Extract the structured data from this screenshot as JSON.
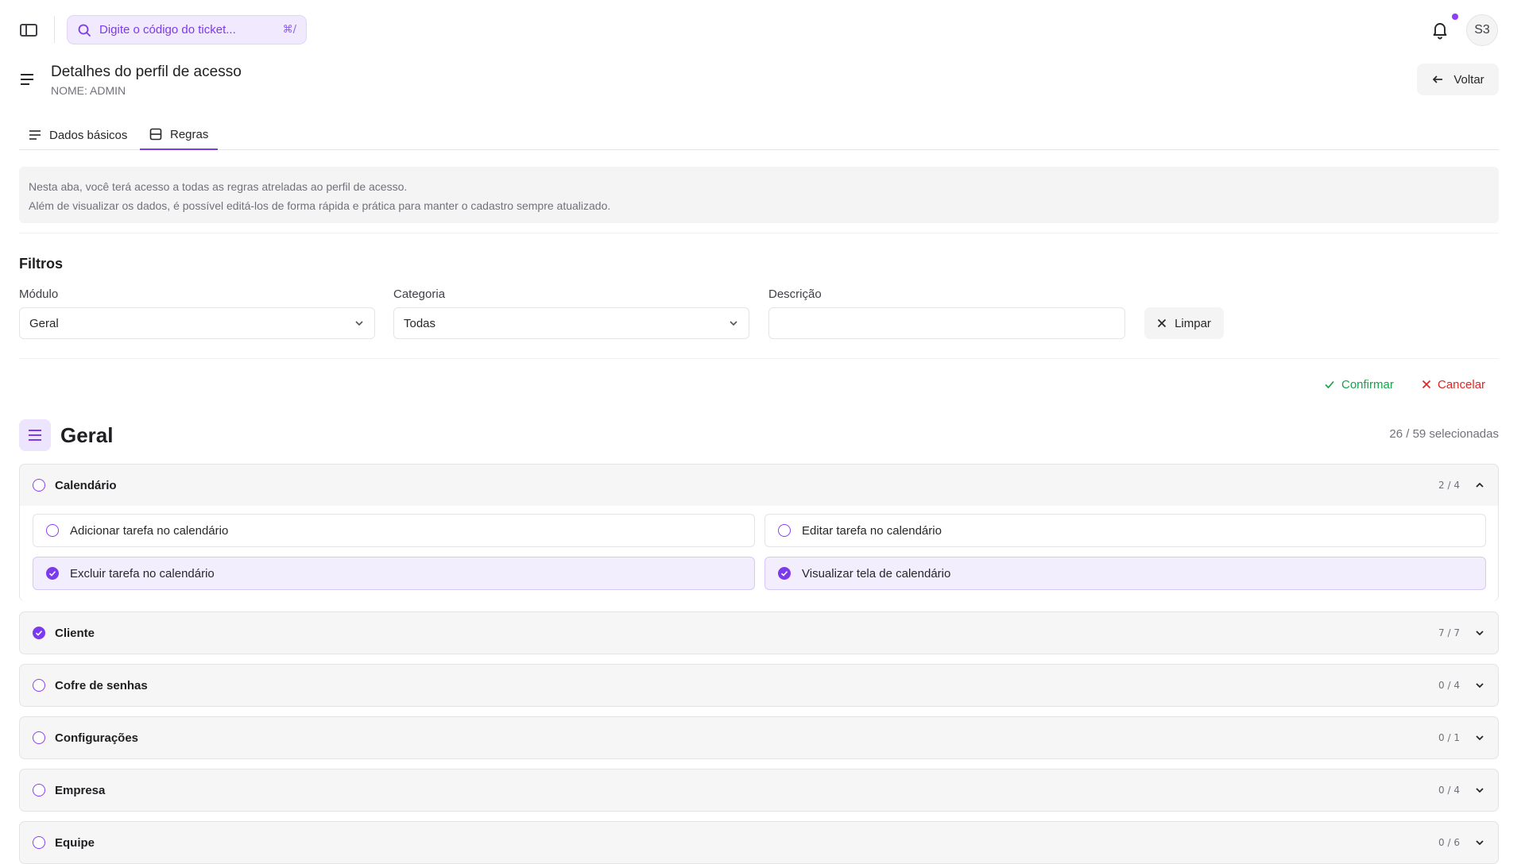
{
  "topbar": {
    "search_placeholder": "Digite o código do ticket...",
    "search_shortcut": "⌘/",
    "avatar_initials": "S3"
  },
  "header": {
    "title": "Detalhes do perfil de acesso",
    "subtitle": "NOME: ADMIN",
    "back_label": "Voltar"
  },
  "tabs": [
    {
      "label": "Dados básicos",
      "active": false
    },
    {
      "label": "Regras",
      "active": true
    }
  ],
  "info": {
    "line1": "Nesta aba, você terá acesso a todas as regras atreladas ao perfil de acesso.",
    "line2": "Além de visualizar os dados, é possível editá-los de forma rápida e prática para manter o cadastro sempre atualizado."
  },
  "filters": {
    "title": "Filtros",
    "modulo_label": "Módulo",
    "modulo_value": "Geral",
    "categoria_label": "Categoria",
    "categoria_value": "Todas",
    "descricao_label": "Descrição",
    "descricao_value": "",
    "clear_label": "Limpar"
  },
  "actions": {
    "confirm_label": "Confirmar",
    "cancel_label": "Cancelar"
  },
  "section": {
    "title": "Geral",
    "count": "26 / 59 selecionadas"
  },
  "groups": [
    {
      "name": "Calendário",
      "count": "2 / 4",
      "checked": false,
      "expanded": true,
      "rules": [
        {
          "label": "Adicionar tarefa no calendário",
          "checked": false
        },
        {
          "label": "Editar tarefa no calendário",
          "checked": false
        },
        {
          "label": "Excluir tarefa no calendário",
          "checked": true
        },
        {
          "label": "Visualizar tela de calendário",
          "checked": true
        }
      ]
    },
    {
      "name": "Cliente",
      "count": "7 / 7",
      "checked": true,
      "expanded": false
    },
    {
      "name": "Cofre de senhas",
      "count": "0 / 4",
      "checked": false,
      "expanded": false
    },
    {
      "name": "Configurações",
      "count": "0 / 1",
      "checked": false,
      "expanded": false
    },
    {
      "name": "Empresa",
      "count": "0 / 4",
      "checked": false,
      "expanded": false
    },
    {
      "name": "Equipe",
      "count": "0 / 6",
      "checked": false,
      "expanded": false
    }
  ],
  "colors": {
    "accent": "#7c3aed",
    "confirm": "#16a34a",
    "cancel": "#dc2626"
  }
}
